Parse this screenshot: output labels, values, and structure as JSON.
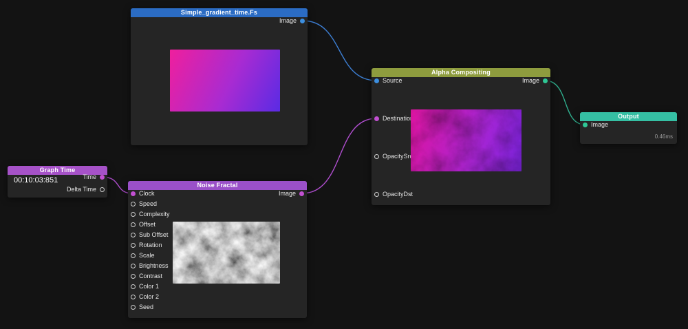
{
  "canvas": {
    "background": "#131313"
  },
  "port_colors": {
    "blue": "#3d8fe0",
    "magenta": "#c250d2",
    "green": "#2fc795",
    "unconnected_ring": "#cfcfcf"
  },
  "edges": [
    {
      "id": "gradient-image-to-alpha-source",
      "color": "#3d7fd4"
    },
    {
      "id": "graphtime-time-to-noise-clock",
      "color": "#b04ecf"
    },
    {
      "id": "noise-image-to-alpha-destination",
      "color": "#b04ecf"
    },
    {
      "id": "alpha-image-to-output-image",
      "color": "#2fae8d"
    }
  ],
  "nodes": {
    "gradient": {
      "title": "Simple_gradient_time.Fs",
      "header_color": "#2b6cc4",
      "outputs": [
        {
          "label": "Image"
        }
      ]
    },
    "graph_time": {
      "title": "Graph Time",
      "header_color": "#a652c8",
      "time_value": "00:10:03:851",
      "outputs": [
        {
          "label": "Time"
        },
        {
          "label": "Delta Time"
        }
      ]
    },
    "noise_fractal": {
      "title": "Noise Fractal",
      "header_color": "#9a50c8",
      "inputs": [
        {
          "label": "Clock"
        },
        {
          "label": "Speed"
        },
        {
          "label": "Complexity"
        },
        {
          "label": "Offset"
        },
        {
          "label": "Sub Offset"
        },
        {
          "label": "Rotation"
        },
        {
          "label": "Scale"
        },
        {
          "label": "Brightness"
        },
        {
          "label": "Contrast"
        },
        {
          "label": "Color 1"
        },
        {
          "label": "Color 2"
        },
        {
          "label": "Seed"
        }
      ],
      "outputs": [
        {
          "label": "Image"
        }
      ]
    },
    "alpha_compositing": {
      "title": "Alpha Compositing",
      "header_color": "#8e9c3e",
      "inputs": [
        {
          "label": "Source"
        },
        {
          "label": "Destination"
        },
        {
          "label": "OpacitySrc"
        },
        {
          "label": "OpacityDst"
        }
      ],
      "outputs": [
        {
          "label": "Image"
        }
      ]
    },
    "output": {
      "title": "Output",
      "header_color": "#35bfa3",
      "inputs": [
        {
          "label": "Image"
        }
      ],
      "timing": "0.46ms"
    }
  }
}
